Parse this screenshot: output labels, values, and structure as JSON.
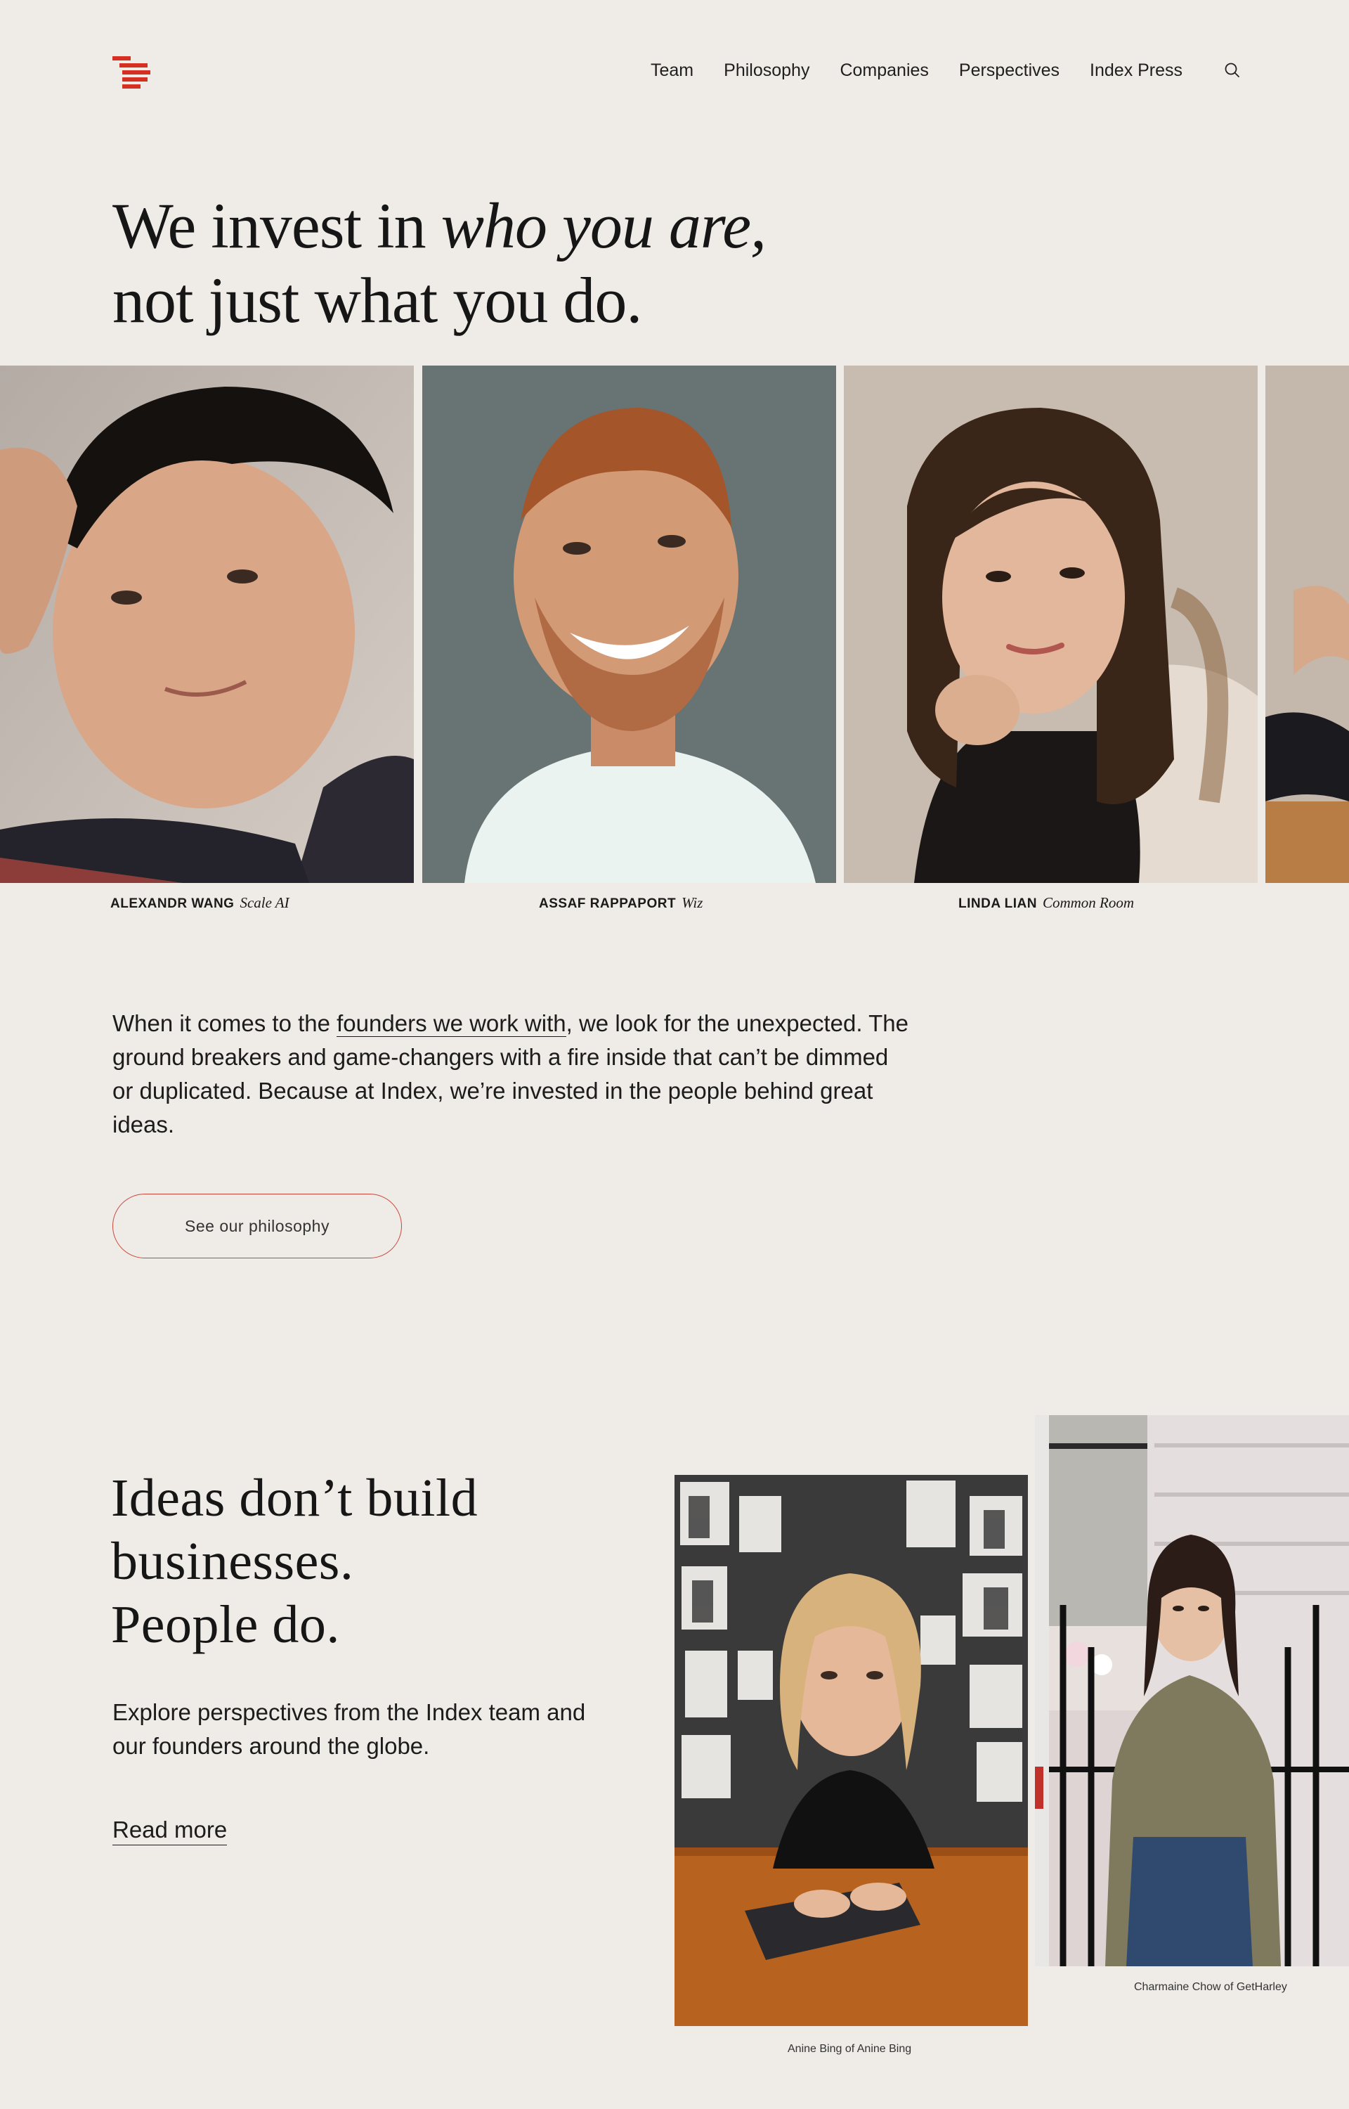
{
  "header": {
    "logo_alt": "Index Ventures",
    "nav": [
      {
        "label": "Team"
      },
      {
        "label": "Philosophy"
      },
      {
        "label": "Companies"
      },
      {
        "label": "Perspectives"
      },
      {
        "label": "Index Press"
      }
    ],
    "search_icon": "search-icon"
  },
  "hero": {
    "line1_start": "We invest in ",
    "line1_emphasis": "who you are,",
    "line2": "not just what you do."
  },
  "founders": [
    {
      "name": "Alexandr Wang",
      "company": "Scale AI"
    },
    {
      "name": "Assaf Rappaport",
      "company": "Wiz"
    },
    {
      "name": "Linda Lian",
      "company": "Common Room"
    }
  ],
  "intro": {
    "before_link": "When it comes to the ",
    "link": "founders we work with",
    "after_link": ", we look for the unexpected. The ground breakers and game-changers with a fire inside that can’t be dimmed or duplicated. Because at Index, we’re invested in the people behind great ideas.",
    "button": "See our philosophy"
  },
  "perspectives": {
    "title_line1": "Ideas don’t build",
    "title_line2": "businesses.",
    "title_line3": "People do.",
    "text": "Explore perspectives from the Index team and our founders around the globe.",
    "read_more": "Read more",
    "photo1_caption": "Anine Bing of Anine Bing",
    "photo2_caption": "Charmaine Chow of GetHarley"
  },
  "colors": {
    "background": "#efebe6",
    "accent": "#d42f21",
    "button_border": "#c8453a"
  }
}
